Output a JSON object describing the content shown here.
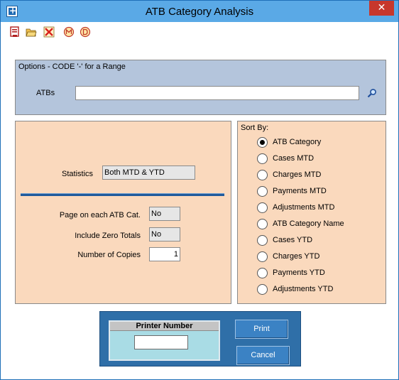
{
  "window": {
    "title": "ATB Category Analysis",
    "close_glyph": "✕"
  },
  "toolbar": [
    {
      "icon": "save-report-icon"
    },
    {
      "icon": "open-folder-icon"
    },
    {
      "icon": "close-red-x-icon"
    },
    {
      "icon": "m-circle-icon"
    },
    {
      "icon": "d-circle-icon"
    }
  ],
  "options": {
    "caption": "Options - CODE '-' for a Range",
    "atbs_label": "ATBs",
    "atbs_value": ""
  },
  "statistics": {
    "label": "Statistics",
    "value": "Both MTD & YTD"
  },
  "page_on_each": {
    "label": "Page on each ATB Cat.",
    "value": "No"
  },
  "include_zero": {
    "label": "Include Zero Totals",
    "value": "No"
  },
  "copies": {
    "label": "Number of Copies",
    "value": "1"
  },
  "sort_by": {
    "caption": "Sort By:",
    "options": [
      {
        "label": "ATB Category",
        "selected": true
      },
      {
        "label": "Cases MTD",
        "selected": false
      },
      {
        "label": "Charges MTD",
        "selected": false
      },
      {
        "label": "Payments MTD",
        "selected": false
      },
      {
        "label": "Adjustments MTD",
        "selected": false
      },
      {
        "label": "ATB Category Name",
        "selected": false
      },
      {
        "label": "Cases YTD",
        "selected": false
      },
      {
        "label": "Charges YTD",
        "selected": false
      },
      {
        "label": "Payments YTD",
        "selected": false
      },
      {
        "label": "Adjustments YTD",
        "selected": false
      }
    ]
  },
  "printer": {
    "title": "Printer Number",
    "value": ""
  },
  "buttons": {
    "print": "Print",
    "cancel": "Cancel"
  },
  "colors": {
    "title_bar": "#5aa9e6",
    "options_panel": "#b4c5dc",
    "form_panel": "#fad9bd",
    "print_area": "#2f6fa8",
    "close_button": "#c7372c"
  }
}
